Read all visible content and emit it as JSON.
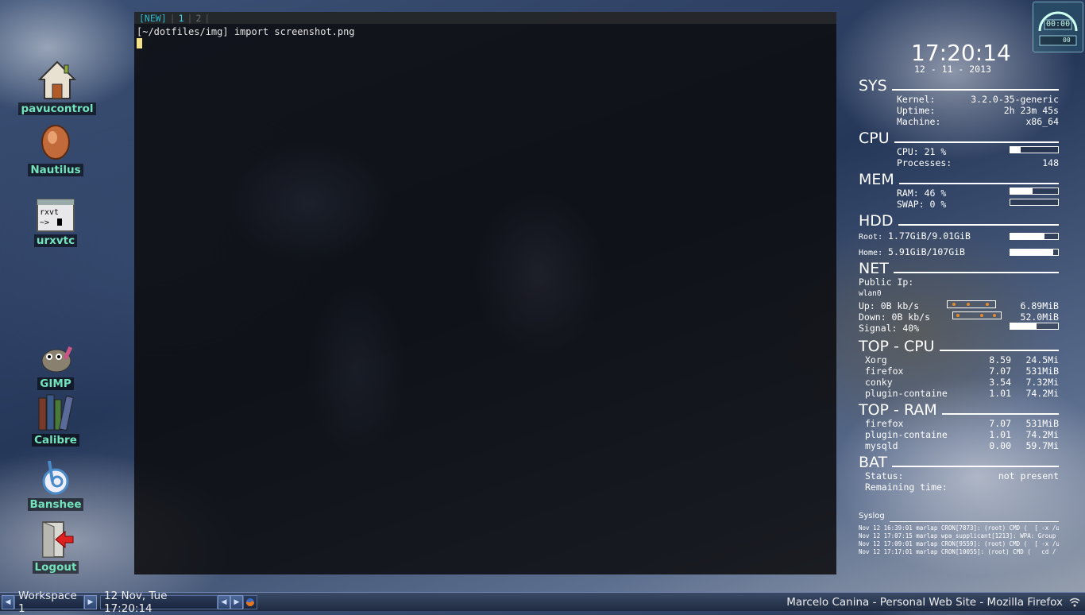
{
  "terminal": {
    "tabs": [
      "[NEW]",
      "1",
      "2"
    ],
    "tab_sep": "|",
    "prompt_line": "[~/dotfiles/img] import screenshot.png"
  },
  "desktop_icons": [
    {
      "label": "pavucontrol",
      "icon": "home-icon"
    },
    {
      "label": "Nautilus",
      "icon": "nautilus-icon"
    },
    {
      "label": "urxvtc",
      "icon": "terminal-icon",
      "glyph_text": "rxvt\n~> █"
    },
    {
      "label": "GIMP",
      "icon": "gimp-icon"
    },
    {
      "label": "Calibre",
      "icon": "books-icon"
    },
    {
      "label": "Banshee",
      "icon": "banshee-icon"
    },
    {
      "label": "Logout",
      "icon": "logout-icon"
    }
  ],
  "clock_widget": {
    "time": "00:00",
    "sub": "00"
  },
  "conky": {
    "clock": "17:20:14",
    "date": "12 - 11 - 2013",
    "sys": {
      "title": "SYS",
      "kernel_label": "Kernel:",
      "kernel": "3.2.0-35-generic",
      "uptime_label": "Uptime:",
      "uptime": "2h 23m 45s",
      "machine_label": "Machine:",
      "machine": "x86_64"
    },
    "cpu": {
      "title": "CPU",
      "usage_label": "CPU: 21 %",
      "usage": 0.21,
      "processes_label": "Processes:",
      "processes": "148"
    },
    "mem": {
      "title": "MEM",
      "ram_label": "RAM: 46 %",
      "ram": 0.46,
      "swap_label": "SWAP: 0 %",
      "swap": 0.0
    },
    "hdd": {
      "title": "HDD",
      "root_label": "Root:",
      "root": "1.77GiB/9.01GiB",
      "root_usage": 0.72,
      "home_label": "Home:",
      "home": "5.91GiB/107GiB",
      "home_usage": 0.9
    },
    "net": {
      "title": "NET",
      "public_ip_label": "Public Ip:",
      "iface": "wlan0",
      "up_label": "Up: 0B kb/s",
      "up_total": "6.89MiB",
      "down_label": "Down: 0B kb/s",
      "down_total": "52.0MiB",
      "signal_label": "Signal: 40%",
      "signal": 0.55
    },
    "top_cpu": {
      "title": "TOP - CPU",
      "rows": [
        {
          "name": "Xorg",
          "cpu": "8.59",
          "mem": "24.5Mi"
        },
        {
          "name": "firefox",
          "cpu": "7.07",
          "mem": "531MiB"
        },
        {
          "name": "conky",
          "cpu": "3.54",
          "mem": "7.32Mi"
        },
        {
          "name": "plugin-containe",
          "cpu": "1.01",
          "mem": "74.2Mi"
        }
      ]
    },
    "top_ram": {
      "title": "TOP - RAM",
      "rows": [
        {
          "name": "firefox",
          "cpu": "7.07",
          "mem": "531MiB"
        },
        {
          "name": "plugin-containe",
          "cpu": "1.01",
          "mem": "74.2Mi"
        },
        {
          "name": "mysqld",
          "cpu": "0.00",
          "mem": "59.7Mi"
        }
      ]
    },
    "bat": {
      "title": "BAT",
      "status_label": "Status:",
      "status": "not present",
      "remaining_label": "Remaining time:"
    },
    "syslog": {
      "title": "Syslog",
      "lines": [
        "Nov 12 16:39:01 marlap CRON[7873]: (root) CMD (  [ -x /usr/",
        "Nov 12 17:07:15 marlap wpa_supplicant[1213]: WPA: Group r",
        "Nov 12 17:09:01 marlap CRON[9559]: (root) CMD (  [ -x /usr/",
        "Nov 12 17:17:01 marlap CRON[10055]: (root) CMD (   cd / &"
      ]
    }
  },
  "taskbar": {
    "workspace": "Workspace 1",
    "datetime": "12 Nov, Tue 17:20:14",
    "window_title": "Marcelo Canina - Personal Web Site - Mozilla Firefox",
    "accent": "#3a4a66"
  }
}
